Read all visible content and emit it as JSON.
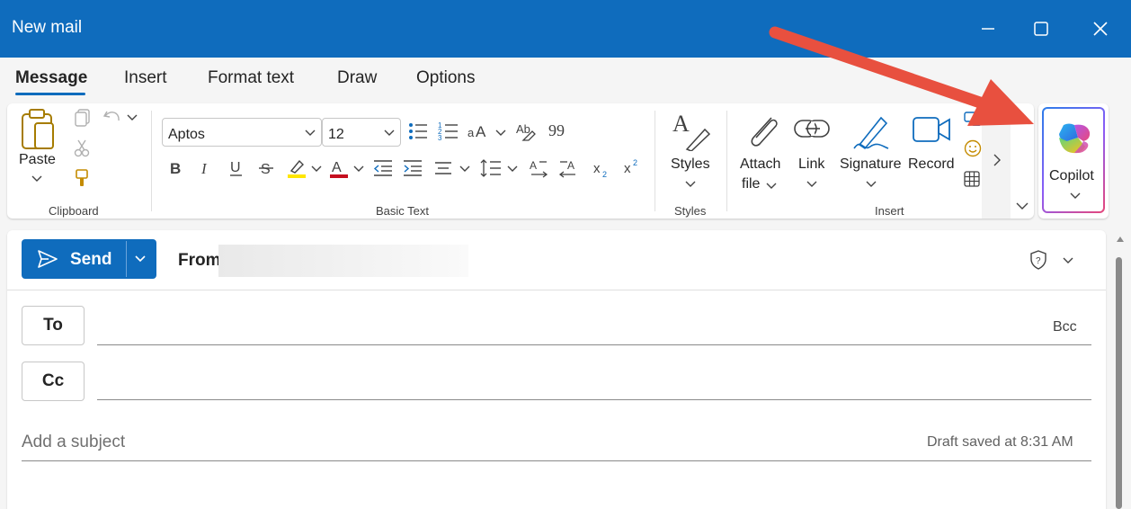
{
  "window": {
    "title": "New mail"
  },
  "tabs": [
    {
      "label": "Message",
      "active": true
    },
    {
      "label": "Insert"
    },
    {
      "label": "Format text"
    },
    {
      "label": "Draw"
    },
    {
      "label": "Options"
    }
  ],
  "ribbon": {
    "clipboard": {
      "paste_label": "Paste",
      "group_label": "Clipboard"
    },
    "basic_text": {
      "font_name": "Aptos",
      "font_size": "12",
      "group_label": "Basic Text"
    },
    "styles": {
      "button_label": "Styles",
      "group_label": "Styles"
    },
    "insert": {
      "attach_label_1": "Attach",
      "attach_label_2": "file",
      "link_label": "Link",
      "signature_label": "Signature",
      "record_label": "Record",
      "group_label": "Insert"
    },
    "copilot": {
      "label": "Copilot"
    }
  },
  "compose": {
    "send_label": "Send",
    "from_label": "From",
    "to_label": "To",
    "cc_label": "Cc",
    "bcc_label": "Bcc",
    "subject_placeholder": "Add a subject",
    "draft_status": "Draft saved at 8:31 AM"
  },
  "colors": {
    "accent": "#0f6cbd",
    "annotation_arrow": "#e8503f",
    "highlight_yellow": "#ffe600",
    "font_color_red": "#c50f1f"
  }
}
